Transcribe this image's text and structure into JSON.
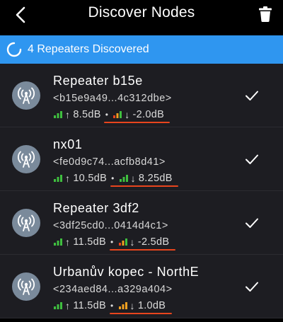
{
  "header": {
    "title": "Discover Nodes",
    "back_icon": "chevron-left-icon",
    "trash_icon": "trash-icon"
  },
  "status": {
    "text": "4 Repeaters Discovered",
    "icon": "spinner-icon",
    "color": "#2f96f0"
  },
  "colors": {
    "signal_good": "#3fbf3f",
    "signal_mid": "#f0a020",
    "signal_bad": "#e8451d",
    "underline": "#e8451d",
    "avatar_bg": "#7a8a9b",
    "row_bg": "#1d1d22"
  },
  "nodes": [
    {
      "name": "Repeater b15e",
      "id": "<b15e9a49...4c312dbe>",
      "tx": "8.5dB",
      "rx": "-2.0dB",
      "rx_quality": "poor",
      "selected": true
    },
    {
      "name": "nx01",
      "id": "<fe0d9c74...acfb8d41>",
      "tx": "10.5dB",
      "rx": "8.25dB",
      "rx_quality": "good",
      "selected": true
    },
    {
      "name": "Repeater 3df2",
      "id": "<3df25cd0...0414d4c1>",
      "tx": "11.5dB",
      "rx": "-2.5dB",
      "rx_quality": "poor",
      "selected": true
    },
    {
      "name": "Urbanův kopec - NorthE",
      "id": "<234aed84...a329a404>",
      "tx": "11.5dB",
      "rx": "1.0dB",
      "rx_quality": "fair",
      "selected": true
    }
  ],
  "symbols": {
    "up_arrow": "↑",
    "down_arrow": "↓",
    "separator": "•"
  }
}
